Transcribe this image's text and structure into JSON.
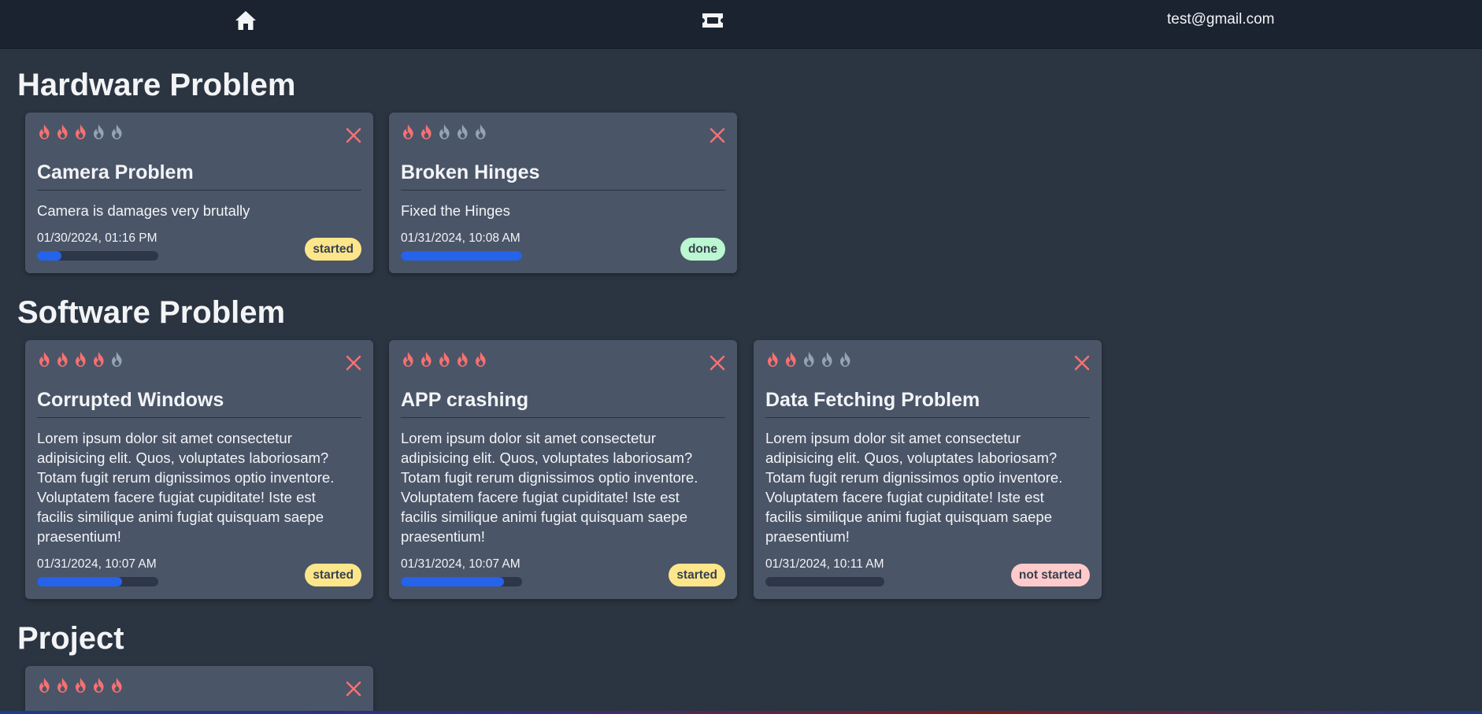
{
  "nav": {
    "home_icon": "home-icon",
    "ticket_icon": "ticket-icon",
    "user_email": "test@gmail.com"
  },
  "colors": {
    "flame_active": "#f87171",
    "flame_inactive": "#94a3b8",
    "close": "#f87171",
    "progress": "#2563eb",
    "badge_started": "#fde68a",
    "badge_done": "#bbf7d0",
    "badge_not_started": "#fecaca"
  },
  "sections": [
    {
      "title": "Hardware Problem",
      "tickets": [
        {
          "title": "Camera Problem",
          "description": "Camera is damages very brutally",
          "date": "01/30/2024, 01:16 PM",
          "priority": 3,
          "progress": 0.2,
          "status": "started"
        },
        {
          "title": "Broken Hinges",
          "description": "Fixed the Hinges",
          "date": "01/31/2024, 10:08 AM",
          "priority": 2,
          "progress": 1.0,
          "status": "done"
        }
      ]
    },
    {
      "title": "Software Problem",
      "tickets": [
        {
          "title": "Corrupted Windows",
          "description": "Lorem ipsum dolor sit amet consectetur adipisicing elit. Quos, voluptates laboriosam? Totam fugit rerum dignissimos optio inventore. Voluptatem facere fugiat cupiditate! Iste est facilis similique animi fugiat quisquam saepe praesentium!",
          "date": "01/31/2024, 10:07 AM",
          "priority": 4,
          "progress": 0.7,
          "status": "started"
        },
        {
          "title": "APP crashing",
          "description": "Lorem ipsum dolor sit amet consectetur adipisicing elit. Quos, voluptates laboriosam? Totam fugit rerum dignissimos optio inventore. Voluptatem facere fugiat cupiditate! Iste est facilis similique animi fugiat quisquam saepe praesentium!",
          "date": "01/31/2024, 10:07 AM",
          "priority": 5,
          "progress": 0.85,
          "status": "started"
        },
        {
          "title": "Data Fetching Problem",
          "description": "Lorem ipsum dolor sit amet consectetur adipisicing elit. Quos, voluptates laboriosam? Totam fugit rerum dignissimos optio inventore. Voluptatem facere fugiat cupiditate! Iste est facilis similique animi fugiat quisquam saepe praesentium!",
          "date": "01/31/2024, 10:11 AM",
          "priority": 2,
          "progress": 0,
          "status": "not started"
        }
      ]
    },
    {
      "title": "Project",
      "tickets": [
        {
          "title": "",
          "description": "",
          "date": "",
          "priority": 5,
          "progress": 0,
          "status": ""
        }
      ]
    }
  ]
}
